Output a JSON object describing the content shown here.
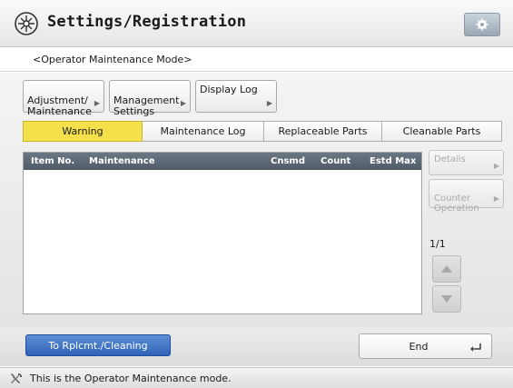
{
  "header": {
    "title": "Settings/Registration",
    "icon": "settings-registration-icon",
    "gear_icon": "gear-icon"
  },
  "mode": {
    "label": "<Operator Maintenance Mode>"
  },
  "top_buttons": [
    {
      "label": "Adjustment/\nMaintenance"
    },
    {
      "label": "Management\nSettings"
    },
    {
      "label": "Display Log"
    }
  ],
  "tabs": [
    {
      "label": "Warning",
      "active": true
    },
    {
      "label": "Maintenance Log"
    },
    {
      "label": "Replaceable Parts"
    },
    {
      "label": "Cleanable Parts"
    }
  ],
  "table": {
    "columns": [
      "Item No.",
      "Maintenance",
      "Cnsmd",
      "Count",
      "Estd Max"
    ],
    "rows": []
  },
  "side": {
    "details_label": "Details",
    "counter_label": "Counter\nOperation",
    "page": "1/1"
  },
  "bottom": {
    "rplc_label": "To Rplcmt./Cleaning",
    "end_label": "End"
  },
  "status": {
    "text": "This is the Operator Maintenance mode.",
    "icon": "maintenance-tools-icon"
  },
  "colors": {
    "accent_yellow": "#F4E04A",
    "accent_blue": "#2F62B7",
    "table_header": "#5E6A77"
  }
}
